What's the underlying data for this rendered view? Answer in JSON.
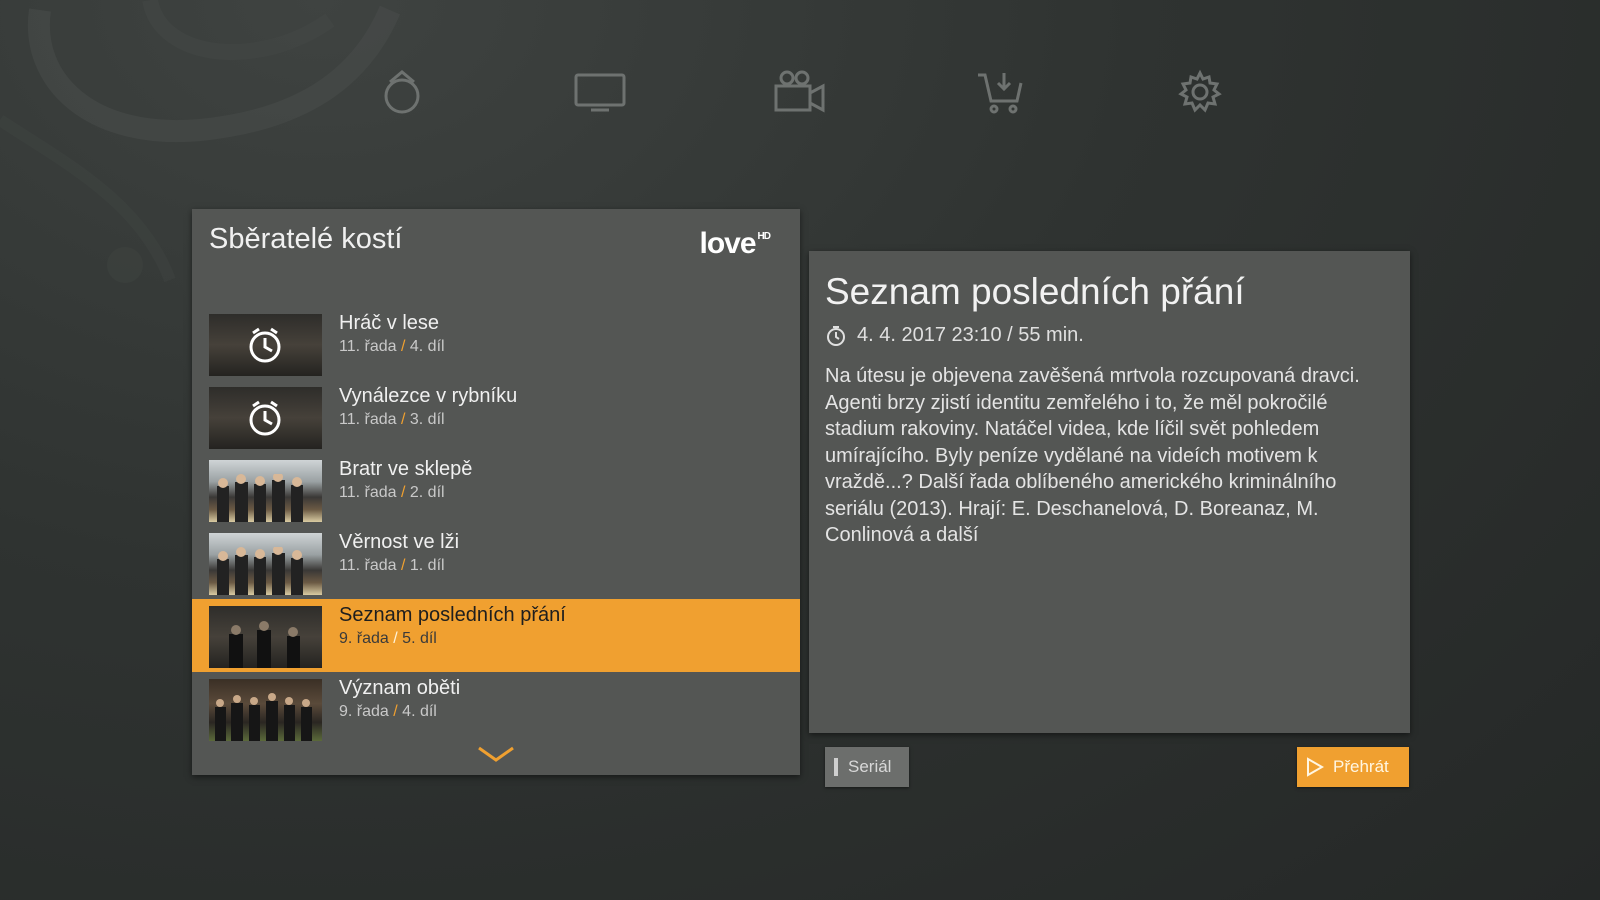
{
  "nav": {
    "items": [
      {
        "name": "home",
        "icon": "home-icon"
      },
      {
        "name": "tv",
        "icon": "tv-icon"
      },
      {
        "name": "video",
        "icon": "video-camera-icon"
      },
      {
        "name": "store",
        "icon": "cart-icon"
      },
      {
        "name": "settings",
        "icon": "gear-icon"
      }
    ]
  },
  "list": {
    "title": "Sběratelé kostí",
    "channel_logo": "love",
    "channel_logo_suffix": "HD",
    "episodes": [
      {
        "title": "Hráč v lese",
        "season": "11. řada",
        "slash": "/",
        "episode": "4. díl",
        "thumb": "alarm-clock"
      },
      {
        "title": "Vynálezce v rybníku",
        "season": "11. řada",
        "slash": "/",
        "episode": "3. díl",
        "thumb": "alarm-clock"
      },
      {
        "title": "Bratr ve sklepě",
        "season": "11. řada",
        "slash": "/",
        "episode": "2. díl",
        "thumb": "cast-photo"
      },
      {
        "title": "Věrnost ve lži",
        "season": "11. řada",
        "slash": "/",
        "episode": "1. díl",
        "thumb": "cast-photo"
      },
      {
        "title": "Seznam posledních přání",
        "season": "9. řada",
        "slash": "/",
        "episode": "5. díl",
        "thumb": "scene-dark",
        "selected": true
      },
      {
        "title": "Význam oběti",
        "season": "9. řada",
        "slash": "/",
        "episode": "4. díl",
        "thumb": "group-photo"
      }
    ]
  },
  "detail": {
    "title": "Seznam posledních přání",
    "datetime": "4. 4. 2017 23:10 / 55 min.",
    "description": "Na útesu je objevena zavěšená mrtvola rozcupovaná dravci. Agenti brzy zjistí identitu zemřelého i to, že měl pokročilé stadium rakoviny. Natáčel videa, kde líčil svět pohledem umírajícího. Byly peníze vydělané na videích motivem k vraždě...? Další řada oblíbeného amerického kriminálního seriálu (2013). Hrají: E. Deschanelová, D. Boreanaz, M. Conlinová a další"
  },
  "buttons": {
    "serial_label": "Seriál",
    "play_label": "Přehrát"
  },
  "colors": {
    "accent": "#f0a030",
    "panel": "#545654",
    "background": "#2f3331"
  }
}
